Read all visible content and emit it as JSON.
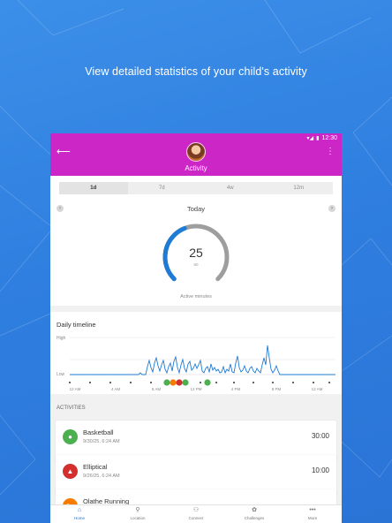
{
  "headline": "View detailed statistics of your child's activity",
  "status_bar": {
    "time": "12:30"
  },
  "app_bar": {
    "title": "Activity",
    "accent_color": "#cc26c7"
  },
  "period_tabs": [
    {
      "label": "1d",
      "active": true
    },
    {
      "label": "7d",
      "active": false
    },
    {
      "label": "4w",
      "active": false
    },
    {
      "label": "12m",
      "active": false
    }
  ],
  "summary": {
    "date_label": "Today",
    "active_minutes": "25",
    "goal": "60",
    "caption": "Active minutes",
    "progress_fraction": 0.42
  },
  "timeline": {
    "title": "Daily timeline",
    "level_high": "High",
    "level_low": "Low",
    "time_labels": [
      "12 AM",
      "4 AM",
      "8 AM",
      "12 PM",
      "4 PM",
      "8 PM",
      "12 AM"
    ]
  },
  "activities_header": "ACTIVITIES",
  "activities": [
    {
      "name": "Basketball",
      "date": "9/30/25, 6:24 AM",
      "duration": "30:00",
      "color": "#4caf50",
      "icon": "basketball-icon"
    },
    {
      "name": "Elliptical",
      "date": "9/26/25, 6:24 AM",
      "duration": "10:00",
      "color": "#d32f2f",
      "icon": "elliptical-icon"
    },
    {
      "name": "Olathe Running",
      "date": "",
      "duration": "",
      "color": "#f57c00",
      "icon": "running-icon"
    }
  ],
  "bottom_nav": [
    {
      "label": "Home",
      "icon": "home-icon",
      "active": true
    },
    {
      "label": "Location",
      "icon": "location-icon",
      "active": false
    },
    {
      "label": "Connect",
      "icon": "connect-icon",
      "active": false
    },
    {
      "label": "Challenges",
      "icon": "challenges-icon",
      "active": false
    },
    {
      "label": "More",
      "icon": "more-icon",
      "active": false
    }
  ]
}
